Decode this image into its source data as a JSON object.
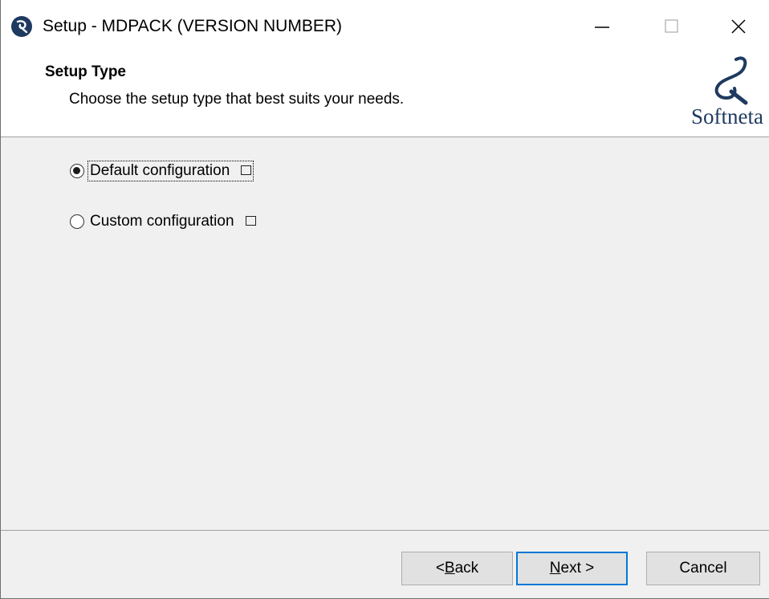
{
  "window": {
    "title": "Setup - MDPACK (VERSION NUMBER)",
    "controls": {
      "minimize": "minimize",
      "maximize": "maximize",
      "close": "close"
    }
  },
  "header": {
    "title": "Setup Type",
    "subtitle": "Choose the setup type that best suits your needs.",
    "logo_text": "Softneta"
  },
  "options": [
    {
      "label": "Default configuration",
      "selected": true
    },
    {
      "label": "Custom configuration",
      "selected": false
    }
  ],
  "buttons": {
    "back": {
      "pre": "< ",
      "mnemonic": "B",
      "post": "ack"
    },
    "next": {
      "pre": "",
      "mnemonic": "N",
      "post": "ext >"
    },
    "cancel": "Cancel"
  },
  "colors": {
    "accent": "#0078d7",
    "logo": "#1f3a60",
    "background": "#f0f0f0"
  }
}
